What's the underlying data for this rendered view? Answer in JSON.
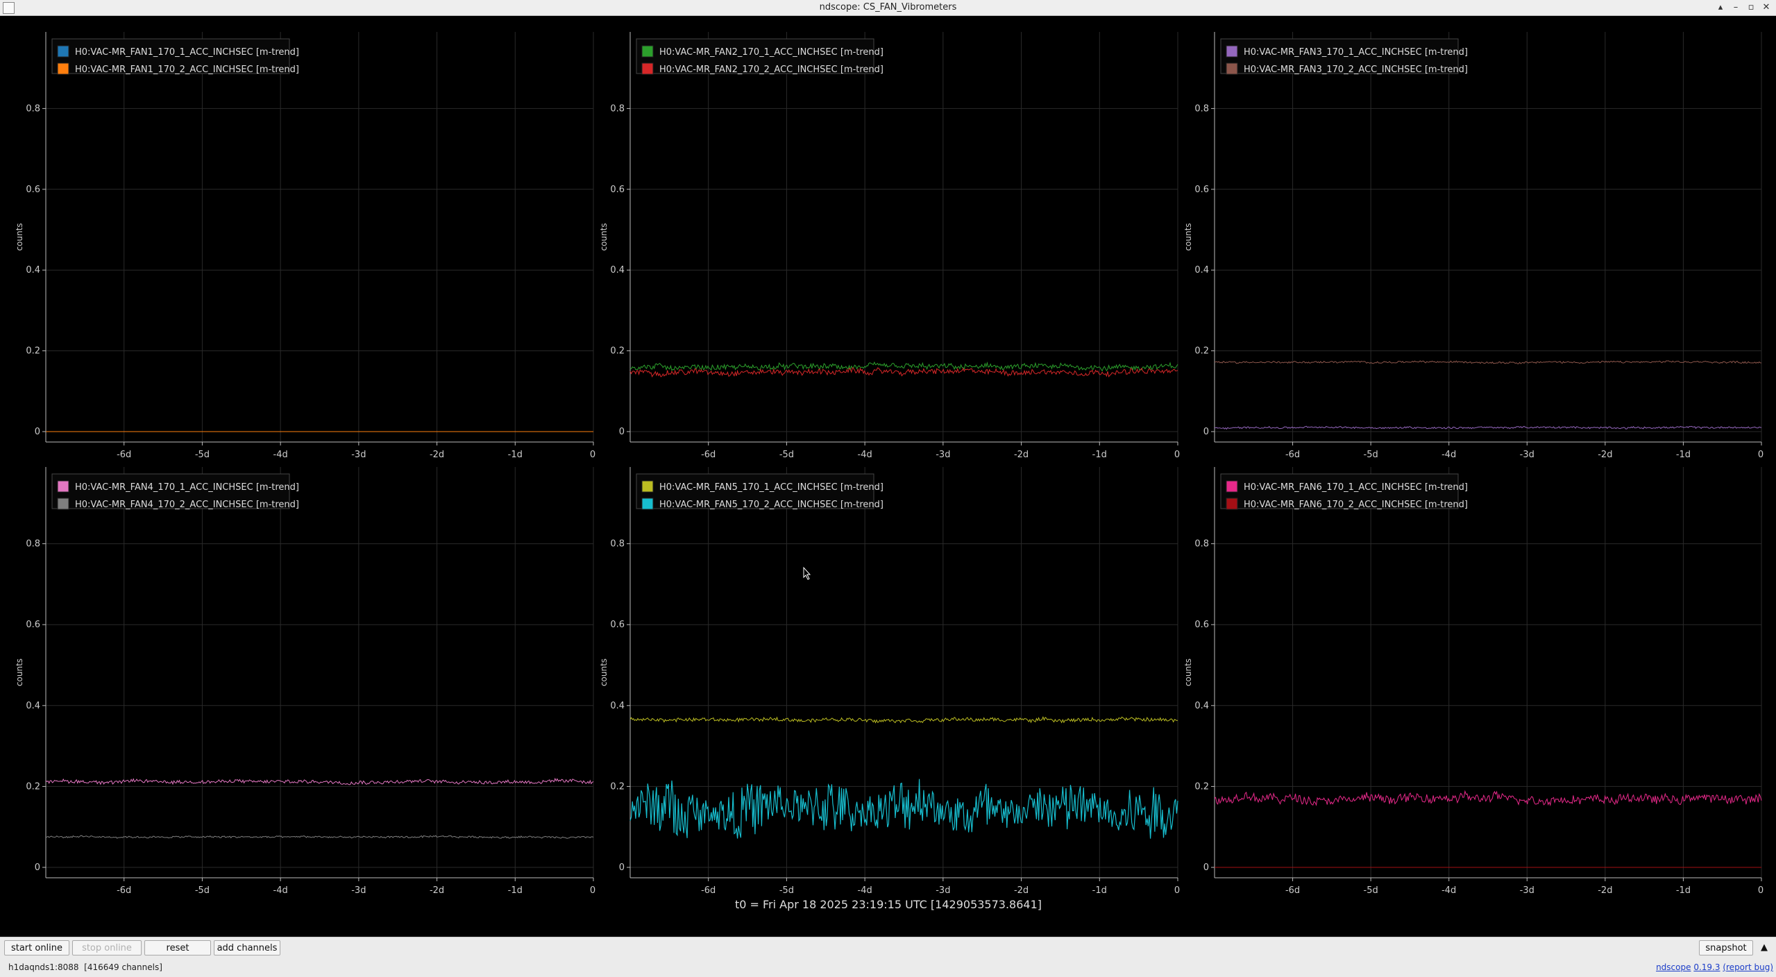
{
  "window": {
    "title": "ndscope: CS_FAN_Vibrometers",
    "controls": [
      "▴",
      "–",
      "▫",
      "✕"
    ]
  },
  "t0_label": "t0 = Fri Apr 18 2025 23:19:15 UTC [1429053573.8641]",
  "toolbar": {
    "start_online": "start online",
    "stop_online": "stop online",
    "reset": "reset",
    "add_channels": "add channels",
    "snapshot": "snapshot",
    "expand_icon": "▲"
  },
  "status": {
    "server": "h1daqnds1:8088",
    "channels": "[416649 channels]",
    "app_name": "ndscope",
    "version": "0.19.3",
    "report_bug": "(report bug)"
  },
  "colors": {
    "background": "#000000",
    "grid": "#2a2a2a",
    "axis": "#bbbbbb"
  },
  "chart_data": [
    {
      "type": "line",
      "ylabel": "counts",
      "ylim": [
        0,
        1
      ],
      "x": [
        "-6d",
        "-5d",
        "-4d",
        "-3d",
        "-2d",
        "-1d",
        "0"
      ],
      "xlim": [
        -7,
        0
      ],
      "yticks": [
        "0",
        "0.2",
        "0.4",
        "0.6",
        "0.8"
      ],
      "legend": "top-left",
      "series": [
        {
          "name": "H0:VAC-MR_FAN1_170_1_ACC_INCHSEC [m-trend]",
          "color": "#1f77b4",
          "level": 0.0,
          "noise": 0.0
        },
        {
          "name": "H0:VAC-MR_FAN1_170_2_ACC_INCHSEC [m-trend]",
          "color": "#ff7f0e",
          "level": 0.0,
          "noise": 0.0
        }
      ]
    },
    {
      "type": "line",
      "ylabel": "counts",
      "ylim": [
        0,
        1
      ],
      "x": [
        "-6d",
        "-5d",
        "-4d",
        "-3d",
        "-2d",
        "-1d",
        "0"
      ],
      "xlim": [
        -7,
        0
      ],
      "yticks": [
        "0",
        "0.2",
        "0.4",
        "0.6",
        "0.8"
      ],
      "legend": "top-left",
      "series": [
        {
          "name": "H0:VAC-MR_FAN2_170_1_ACC_INCHSEC [m-trend]",
          "color": "#2ca02c",
          "level": 0.16,
          "noise": 0.006
        },
        {
          "name": "H0:VAC-MR_FAN2_170_2_ACC_INCHSEC [m-trend]",
          "color": "#d62728",
          "level": 0.148,
          "noise": 0.006
        }
      ]
    },
    {
      "type": "line",
      "ylabel": "counts",
      "ylim": [
        0,
        1
      ],
      "x": [
        "-6d",
        "-5d",
        "-4d",
        "-3d",
        "-2d",
        "-1d",
        "0"
      ],
      "xlim": [
        -7,
        0
      ],
      "yticks": [
        "0",
        "0.2",
        "0.4",
        "0.6",
        "0.8"
      ],
      "legend": "top-left",
      "series": [
        {
          "name": "H0:VAC-MR_FAN3_170_1_ACC_INCHSEC [m-trend]",
          "color": "#9467bd",
          "level": 0.01,
          "noise": 0.002
        },
        {
          "name": "H0:VAC-MR_FAN3_170_2_ACC_INCHSEC [m-trend]",
          "color": "#8c564b",
          "level": 0.172,
          "noise": 0.002
        }
      ]
    },
    {
      "type": "line",
      "ylabel": "counts",
      "ylim": [
        0,
        1
      ],
      "x": [
        "-6d",
        "-5d",
        "-4d",
        "-3d",
        "-2d",
        "-1d",
        "0"
      ],
      "xlim": [
        -7,
        0
      ],
      "yticks": [
        "0",
        "0.2",
        "0.4",
        "0.6",
        "0.8"
      ],
      "legend": "top-left",
      "series": [
        {
          "name": "H0:VAC-MR_FAN4_170_1_ACC_INCHSEC [m-trend]",
          "color": "#e377c2",
          "level": 0.212,
          "noise": 0.004
        },
        {
          "name": "H0:VAC-MR_FAN4_170_2_ACC_INCHSEC [m-trend]",
          "color": "#7f7f7f",
          "level": 0.075,
          "noise": 0.002
        }
      ]
    },
    {
      "type": "line",
      "ylabel": "counts",
      "ylim": [
        0,
        1
      ],
      "x": [
        "-6d",
        "-5d",
        "-4d",
        "-3d",
        "-2d",
        "-1d",
        "0"
      ],
      "xlim": [
        -7,
        0
      ],
      "yticks": [
        "0",
        "0.2",
        "0.4",
        "0.6",
        "0.8"
      ],
      "legend": "top-left",
      "series": [
        {
          "name": "H0:VAC-MR_FAN5_170_1_ACC_INCHSEC [m-trend]",
          "color": "#bcbd22",
          "level": 0.365,
          "noise": 0.004
        },
        {
          "name": "H0:VAC-MR_FAN5_170_2_ACC_INCHSEC [m-trend]",
          "color": "#17becf",
          "level": 0.145,
          "noise": 0.03
        }
      ]
    },
    {
      "type": "line",
      "ylabel": "counts",
      "ylim": [
        0,
        1
      ],
      "x": [
        "-6d",
        "-5d",
        "-4d",
        "-3d",
        "-2d",
        "-1d",
        "0"
      ],
      "xlim": [
        -7,
        0
      ],
      "yticks": [
        "0",
        "0.2",
        "0.4",
        "0.6",
        "0.8"
      ],
      "legend": "top-left",
      "series": [
        {
          "name": "H0:VAC-MR_FAN6_170_1_ACC_INCHSEC [m-trend]",
          "color": "#e7298a",
          "level": 0.17,
          "noise": 0.01
        },
        {
          "name": "H0:VAC-MR_FAN6_170_2_ACC_INCHSEC [m-trend]",
          "color": "#a50f15",
          "level": 0.0,
          "noise": 0.0
        }
      ]
    }
  ]
}
